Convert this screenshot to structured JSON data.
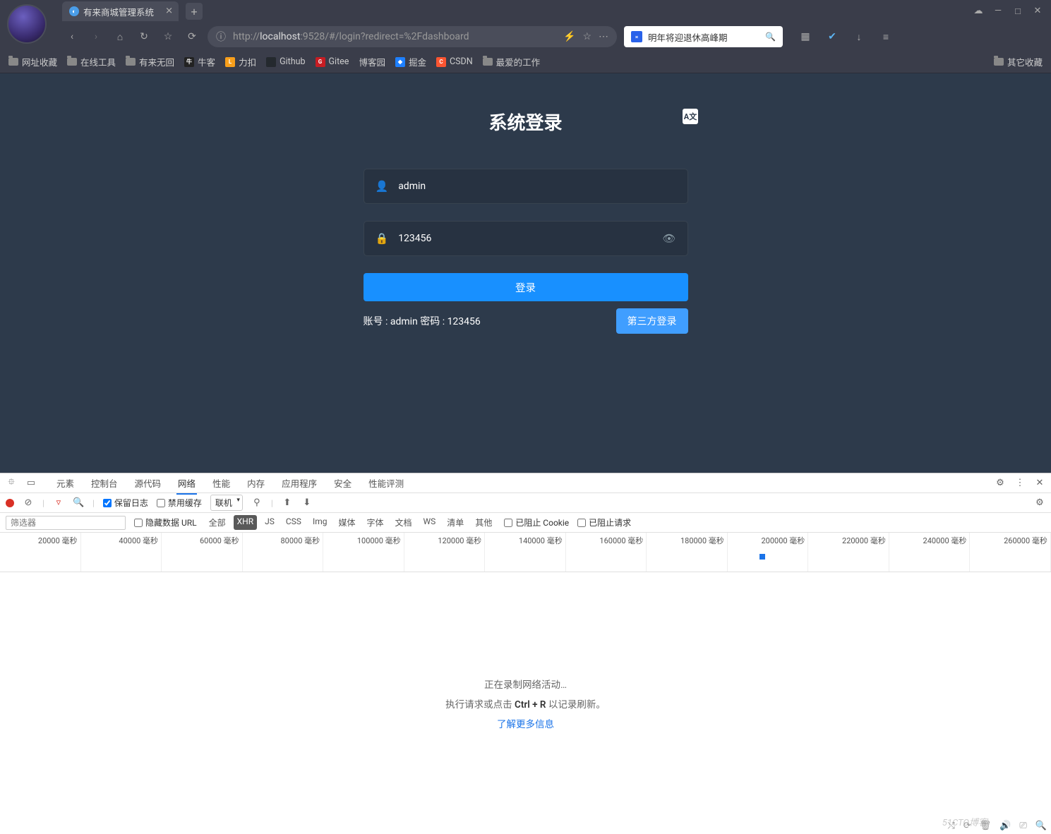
{
  "browser": {
    "tab_title": "有来商城管理系统",
    "url_prefix": "http://",
    "url_host": "localhost",
    "url_rest": ":9528/#/login?redirect=%2Fdashboard",
    "search_placeholder": "明年将迎退休高峰期"
  },
  "window_controls": {
    "cloud": "☁",
    "min": "—",
    "max": "□",
    "close": "✕"
  },
  "nav": {
    "back": "‹",
    "forward": "›",
    "home": "⌂",
    "reload": "↻",
    "star": "☆",
    "refresh2": "⟳",
    "shield": "ⓘ",
    "flash": "⚡",
    "fav": "☆",
    "more": "⋯",
    "search": "🔍",
    "grid": "▦",
    "bird": "✔",
    "down": "↓",
    "menu": "≡"
  },
  "bookmarks": {
    "items": [
      {
        "label": "网址收藏",
        "type": "folder"
      },
      {
        "label": "在线工具",
        "type": "folder"
      },
      {
        "label": "有来无回",
        "type": "folder"
      },
      {
        "label": "牛客",
        "type": "icon",
        "bg": "#222",
        "txt": "牛"
      },
      {
        "label": "力扣",
        "type": "icon",
        "bg": "#f89f1b",
        "txt": "L"
      },
      {
        "label": "Github",
        "type": "icon",
        "bg": "#24292e",
        "txt": ""
      },
      {
        "label": "Gitee",
        "type": "icon",
        "bg": "#c71d23",
        "txt": "G"
      },
      {
        "label": "博客园",
        "type": "plain"
      },
      {
        "label": "掘金",
        "type": "icon",
        "bg": "#1e80ff",
        "txt": "◆"
      },
      {
        "label": "CSDN",
        "type": "icon",
        "bg": "#fc5531",
        "txt": "C"
      },
      {
        "label": "最爱的工作",
        "type": "folder"
      }
    ],
    "right": "其它收藏"
  },
  "login": {
    "title": "系统登录",
    "lang_badge": "A文",
    "username_value": "admin",
    "password_value": "123456",
    "btn_login": "登录",
    "btn_third": "第三方登录",
    "hint": "账号 : admin   密码 : 123456"
  },
  "devtools": {
    "panels": [
      "元素",
      "控制台",
      "源代码",
      "网络",
      "性能",
      "内存",
      "应用程序",
      "安全",
      "性能评测"
    ],
    "active_panel": "网络",
    "toolbar": {
      "preserve_log_label": "保留日志",
      "disable_cache_label": "禁用缓存",
      "throttling": "联机"
    },
    "filters": {
      "placeholder": "筛选器",
      "hide_data_urls": "隐藏数据 URL",
      "types": [
        "全部",
        "XHR",
        "JS",
        "CSS",
        "Img",
        "媒体",
        "字体",
        "文档",
        "WS",
        "清单",
        "其他"
      ],
      "active_type": "XHR",
      "blocked_cookies": "已阻止 Cookie",
      "blocked_requests": "已阻止请求"
    },
    "waterfall_labels": [
      "20000 毫秒",
      "40000 毫秒",
      "60000 毫秒",
      "80000 毫秒",
      "100000 毫秒",
      "120000 毫秒",
      "140000 毫秒",
      "160000 毫秒",
      "180000 毫秒",
      "200000 毫秒",
      "220000 毫秒",
      "240000 毫秒",
      "260000 毫秒"
    ],
    "empty": {
      "line1": "正在录制网络活动…",
      "line2_a": "执行请求或点击 ",
      "line2_b": "Ctrl + R",
      "line2_c": " 以记录刷新。",
      "link": "了解更多信息"
    }
  },
  "watermark": "51CTO博客"
}
